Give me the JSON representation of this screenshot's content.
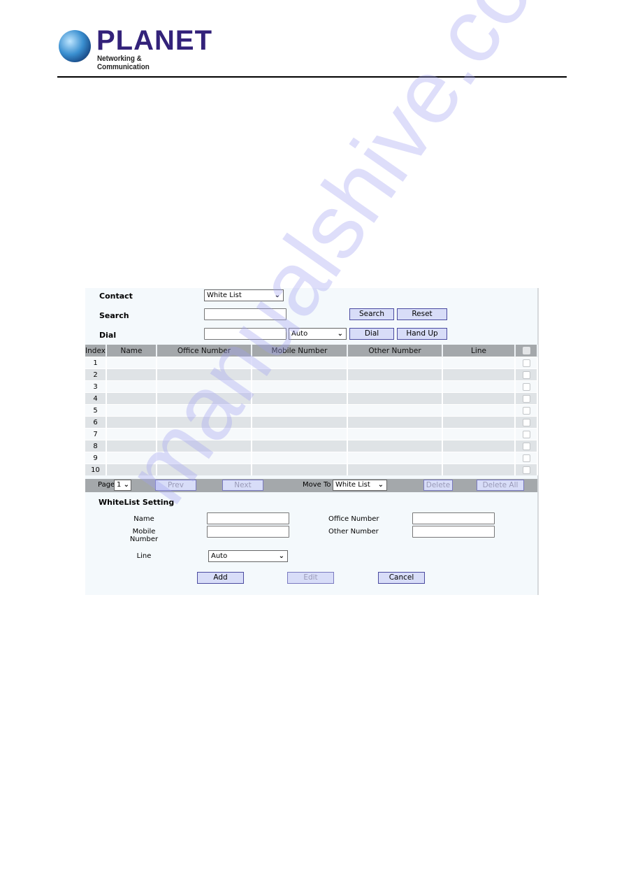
{
  "header": {
    "brand": "PLANET",
    "tagline": "Networking & Communication"
  },
  "watermark": "manualshive.com",
  "form": {
    "contact": {
      "label": "Contact",
      "value": "White List"
    },
    "search": {
      "label": "Search",
      "value": "",
      "search_button": "Search",
      "reset_button": "Reset"
    },
    "dial": {
      "label": "Dial",
      "value": "",
      "line_value": "Auto",
      "dial_button": "Dial",
      "handup_button": "Hand Up"
    }
  },
  "table": {
    "columns": [
      "Index",
      "Name",
      "Office Number",
      "Mobile Number",
      "Other Number",
      "Line"
    ],
    "rows": [
      {
        "index": "1",
        "name": "",
        "office": "",
        "mobile": "",
        "other": "",
        "line": ""
      },
      {
        "index": "2",
        "name": "",
        "office": "",
        "mobile": "",
        "other": "",
        "line": ""
      },
      {
        "index": "3",
        "name": "",
        "office": "",
        "mobile": "",
        "other": "",
        "line": ""
      },
      {
        "index": "4",
        "name": "",
        "office": "",
        "mobile": "",
        "other": "",
        "line": ""
      },
      {
        "index": "5",
        "name": "",
        "office": "",
        "mobile": "",
        "other": "",
        "line": ""
      },
      {
        "index": "6",
        "name": "",
        "office": "",
        "mobile": "",
        "other": "",
        "line": ""
      },
      {
        "index": "7",
        "name": "",
        "office": "",
        "mobile": "",
        "other": "",
        "line": ""
      },
      {
        "index": "8",
        "name": "",
        "office": "",
        "mobile": "",
        "other": "",
        "line": ""
      },
      {
        "index": "9",
        "name": "",
        "office": "",
        "mobile": "",
        "other": "",
        "line": ""
      },
      {
        "index": "10",
        "name": "",
        "office": "",
        "mobile": "",
        "other": "",
        "line": ""
      }
    ]
  },
  "pager": {
    "page_label": "Page",
    "page_value": "1",
    "prev": "Prev",
    "next": "Next",
    "move_to_label": "Move To",
    "move_to_value": "White List",
    "delete": "Delete",
    "delete_all": "Delete All"
  },
  "setting": {
    "title": "WhiteList Setting",
    "name_label": "Name",
    "office_label": "Office Number",
    "mobile_label": "Mobile Number",
    "other_label": "Other Number",
    "line_label": "Line",
    "line_value": "Auto",
    "add": "Add",
    "edit": "Edit",
    "cancel": "Cancel"
  }
}
